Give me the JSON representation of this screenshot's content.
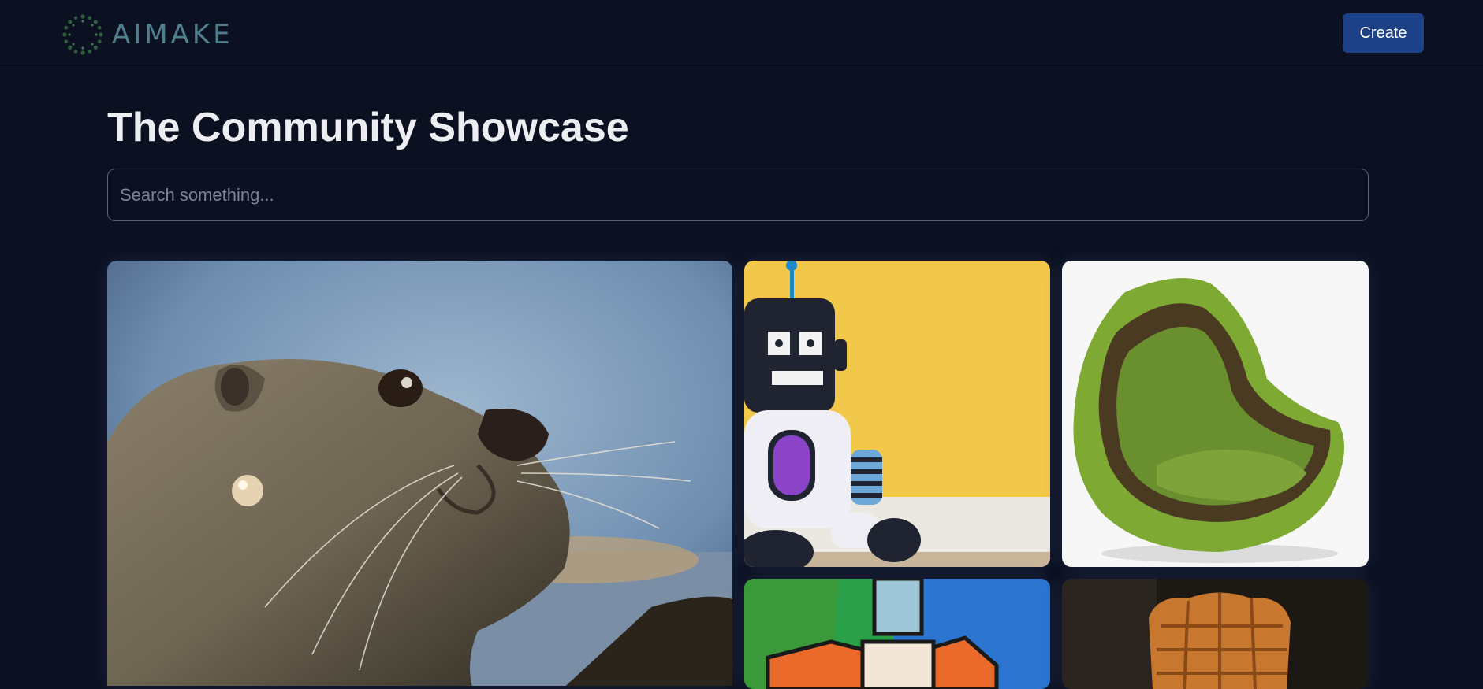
{
  "header": {
    "logo_text": "AIMAKE",
    "logo_icon": "dotted-ring-logo-icon",
    "create_label": "Create"
  },
  "main": {
    "title": "The Community Showcase",
    "search": {
      "value": "",
      "placeholder": "Search something..."
    },
    "gallery": [
      {
        "subject": "otter-portrait"
      },
      {
        "subject": "plush-robot"
      },
      {
        "subject": "avocado-chair"
      },
      {
        "subject": "robot-painting"
      },
      {
        "subject": "bread-loaf"
      }
    ]
  },
  "colors": {
    "background": "#0c1122",
    "accent": "#1d4187",
    "logo": "#4f7f8b"
  }
}
